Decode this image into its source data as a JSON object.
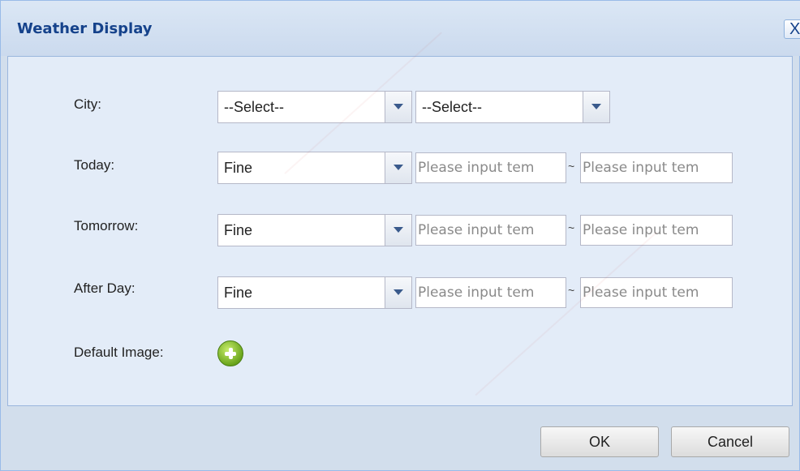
{
  "dialog": {
    "title": "Weather Display",
    "close_glyph": "X"
  },
  "form": {
    "city_label": "City:",
    "city_select_1": "--Select--",
    "city_select_2": "--Select--",
    "today_label": "Today:",
    "today_weather": "Fine",
    "tomorrow_label": "Tomorrow:",
    "tomorrow_weather": "Fine",
    "afterday_label": "After Day:",
    "afterday_weather": "Fine",
    "temp_placeholder": "Please input tem",
    "range_separator": "~",
    "default_image_label": "Default Image:"
  },
  "footer": {
    "ok_label": "OK",
    "cancel_label": "Cancel"
  },
  "colors": {
    "title_text": "#15428b",
    "add_icon": "#6aa51c"
  }
}
